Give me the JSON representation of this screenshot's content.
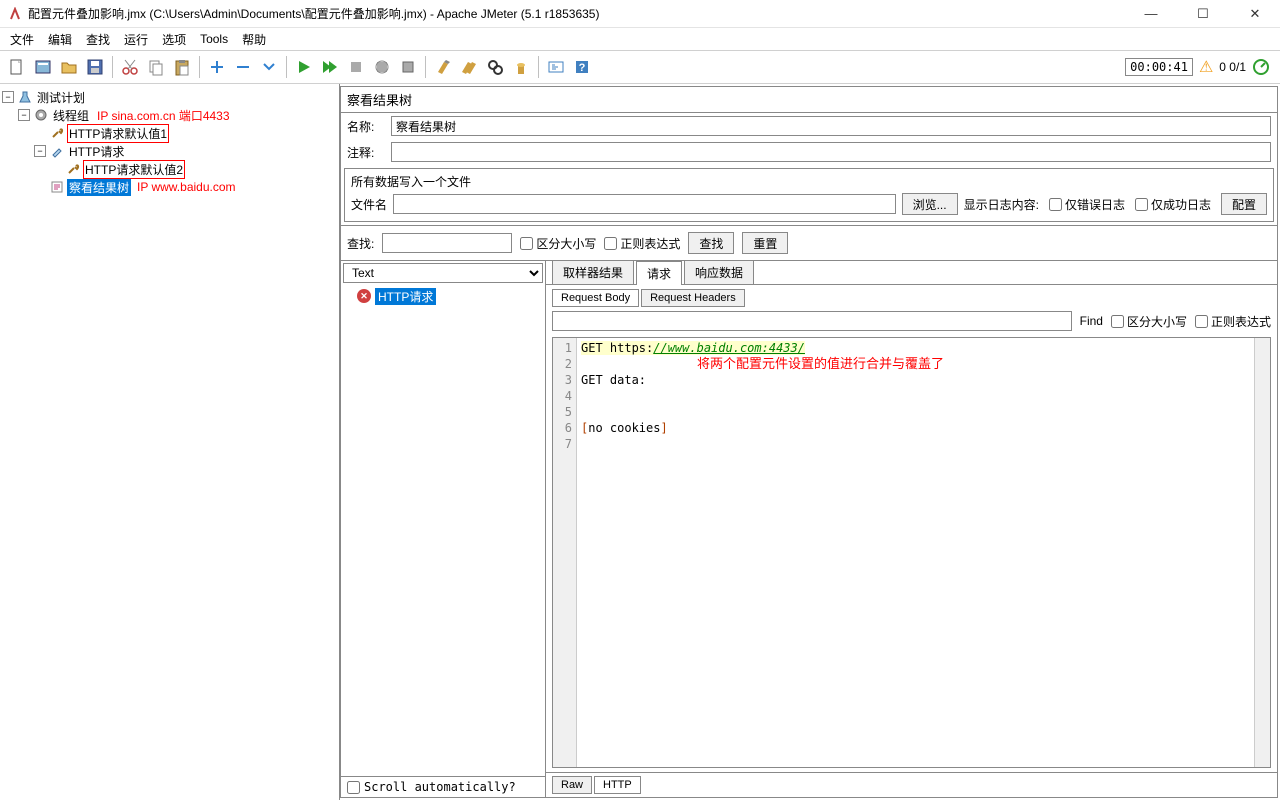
{
  "title": "配置元件叠加影响.jmx (C:\\Users\\Admin\\Documents\\配置元件叠加影响.jmx) - Apache JMeter (5.1 r1853635)",
  "menu": {
    "file": "文件",
    "edit": "编辑",
    "search": "查找",
    "run": "运行",
    "options": "选项",
    "tools": "Tools",
    "help": "帮助"
  },
  "timer": "00:00:41",
  "thread_count": "0 0/1",
  "tree": {
    "root": "测试计划",
    "threadgroup": "线程组",
    "annot1": "IP sina.com.cn 端口4433",
    "httpdef1": "HTTP请求默认值1",
    "httpreq": "HTTP请求",
    "httpdef2": "HTTP请求默认值2",
    "annot2": "IP www.baidu.com",
    "viewtree": "察看结果树"
  },
  "panel": {
    "title": "察看结果树",
    "name_label": "名称:",
    "name_value": "察看结果树",
    "comment_label": "注释:",
    "comment_value": "",
    "fieldset_title": "所有数据写入一个文件",
    "filename_label": "文件名",
    "filename_value": "",
    "browse": "浏览...",
    "log_show": "显示日志内容:",
    "only_err": "仅错误日志",
    "only_ok": "仅成功日志",
    "configure": "配置"
  },
  "searchbar": {
    "label": "查找:",
    "case": "区分大小写",
    "regex": "正则表达式",
    "search_btn": "查找",
    "reset_btn": "重置"
  },
  "renderer": "Text",
  "result_item": "HTTP请求",
  "main_tabs": {
    "sampler": "取样器结果",
    "request": "请求",
    "response": "响应数据"
  },
  "sub_tabs": {
    "body": "Request Body",
    "headers": "Request Headers"
  },
  "find": {
    "btn": "Find",
    "case": "区分大小写",
    "regex": "正则表达式"
  },
  "code": {
    "l1a": "GET https:",
    "l1b": "//www.baidu.com:4433/",
    "l3": "GET data:",
    "l6a": "[",
    "l6b": "no cookies",
    "l6c": "]",
    "annot": "将两个配置元件设置的值进行合并与覆盖了"
  },
  "bottom": {
    "scroll": "Scroll automatically?",
    "raw": "Raw",
    "http": "HTTP"
  }
}
